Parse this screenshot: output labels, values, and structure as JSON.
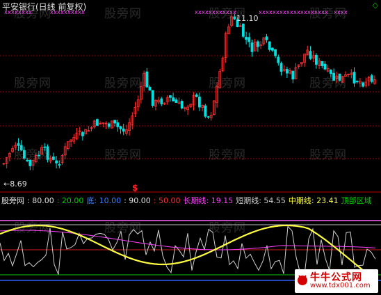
{
  "window": {
    "title": "平安银行(日线 前复权)"
  },
  "main_chart": {
    "high_label": "11.10",
    "low_label": "←8.69",
    "signal_marker": "$",
    "corner_icon": "diamond-icon"
  },
  "indicator_bar": {
    "name": "股旁网",
    "items": [
      {
        "label": ": 80.00",
        "color": "#e0e0e0"
      },
      {
        "label": ": 20.00",
        "color": "#00d000"
      },
      {
        "label": "底: 10.00",
        "color": "#4080ff"
      },
      {
        "label": ": 90.00",
        "color": "#e0e0e0"
      },
      {
        "label": ": 50.00",
        "color": "#ff3030"
      },
      {
        "label": "长期线: 19.15",
        "color": "#ff40ff"
      },
      {
        "label": "短期线: 54.55",
        "color": "#d0d0d0"
      },
      {
        "label": "中期线: 23.41",
        "color": "#ffff40"
      },
      {
        "label": "顶部区域",
        "color": "#00d000"
      }
    ]
  },
  "watermarks": [
    "股旁网"
  ],
  "site_badge": {
    "title": "牛牛公式网",
    "url": "www.tdx001.com"
  },
  "colors": {
    "up": "#ff3030",
    "down": "#00e0e0",
    "grid": "#a00000",
    "medium_line": "#ffff40",
    "long_line": "#ff40ff",
    "short_line": "#d0d0d0"
  }
}
